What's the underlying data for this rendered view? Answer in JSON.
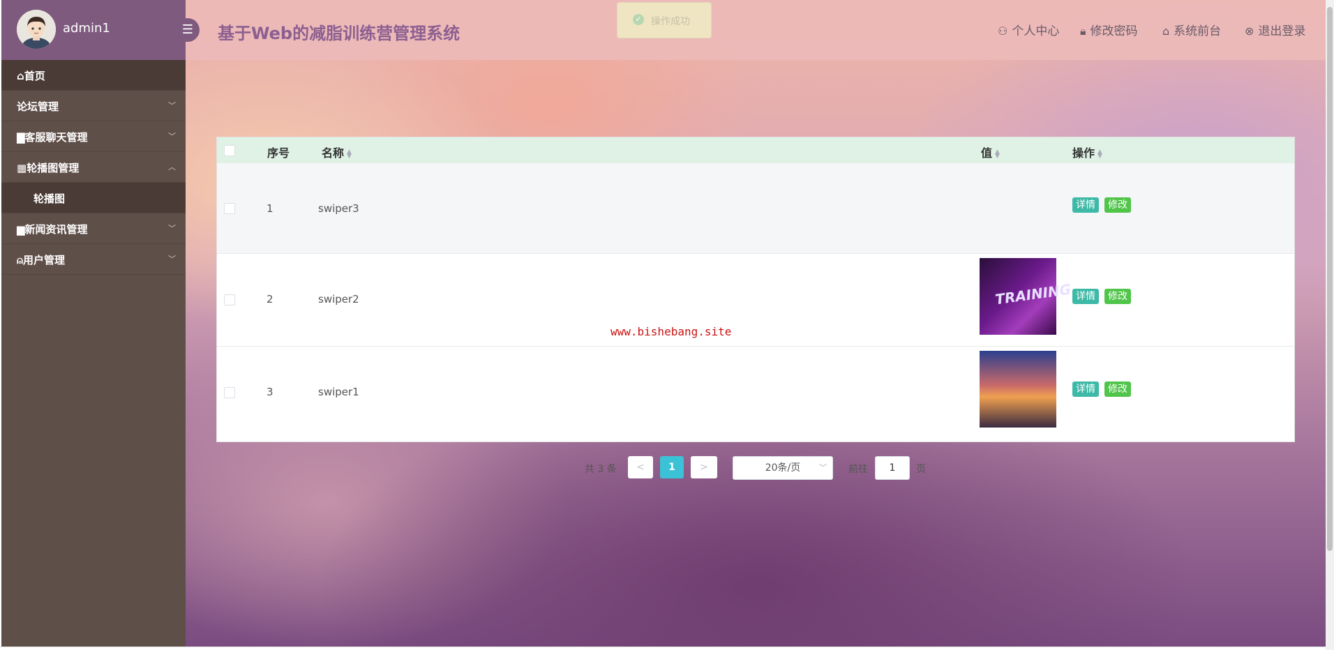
{
  "user": {
    "name": "admin1"
  },
  "app": {
    "title": "基于Web的减脂训练营管理系统"
  },
  "toast": {
    "message": "操作成功"
  },
  "header_links": [
    {
      "label": "个人中心",
      "icon": "user-icon"
    },
    {
      "label": "修改密码",
      "icon": "lock-icon"
    },
    {
      "label": "系统前台",
      "icon": "home-icon"
    },
    {
      "label": "退出登录",
      "icon": "logout-icon"
    }
  ],
  "sidebar": {
    "items": [
      {
        "label": "首页",
        "icon": "home-icon"
      },
      {
        "label": "论坛管理"
      },
      {
        "label": "客服聊天管理",
        "icon": "chat-icon"
      },
      {
        "label": "轮播图管理",
        "icon": "image-icon"
      },
      {
        "label": "轮播图"
      },
      {
        "label": "新闻资讯管理",
        "icon": "news-icon"
      },
      {
        "label": "用户管理",
        "icon": "users-icon"
      }
    ]
  },
  "table": {
    "headers": {
      "index": "序号",
      "name": "名称",
      "value": "值",
      "action": "操作"
    },
    "rows": [
      {
        "index": "1",
        "name": "swiper3",
        "has_image": false
      },
      {
        "index": "2",
        "name": "swiper2",
        "has_image": true,
        "image_text": "TRAINING"
      },
      {
        "index": "3",
        "name": "swiper1",
        "has_image": true
      }
    ],
    "actions": {
      "detail": "详情",
      "edit": "修改"
    }
  },
  "watermark": "www.bishebang.site",
  "pagination": {
    "total_text": "共 3 条",
    "prev": "<",
    "current_page": "1",
    "next": ">",
    "page_size": "20条/页",
    "goto_label": "前往",
    "goto_value": "1",
    "page_suffix": "页"
  }
}
